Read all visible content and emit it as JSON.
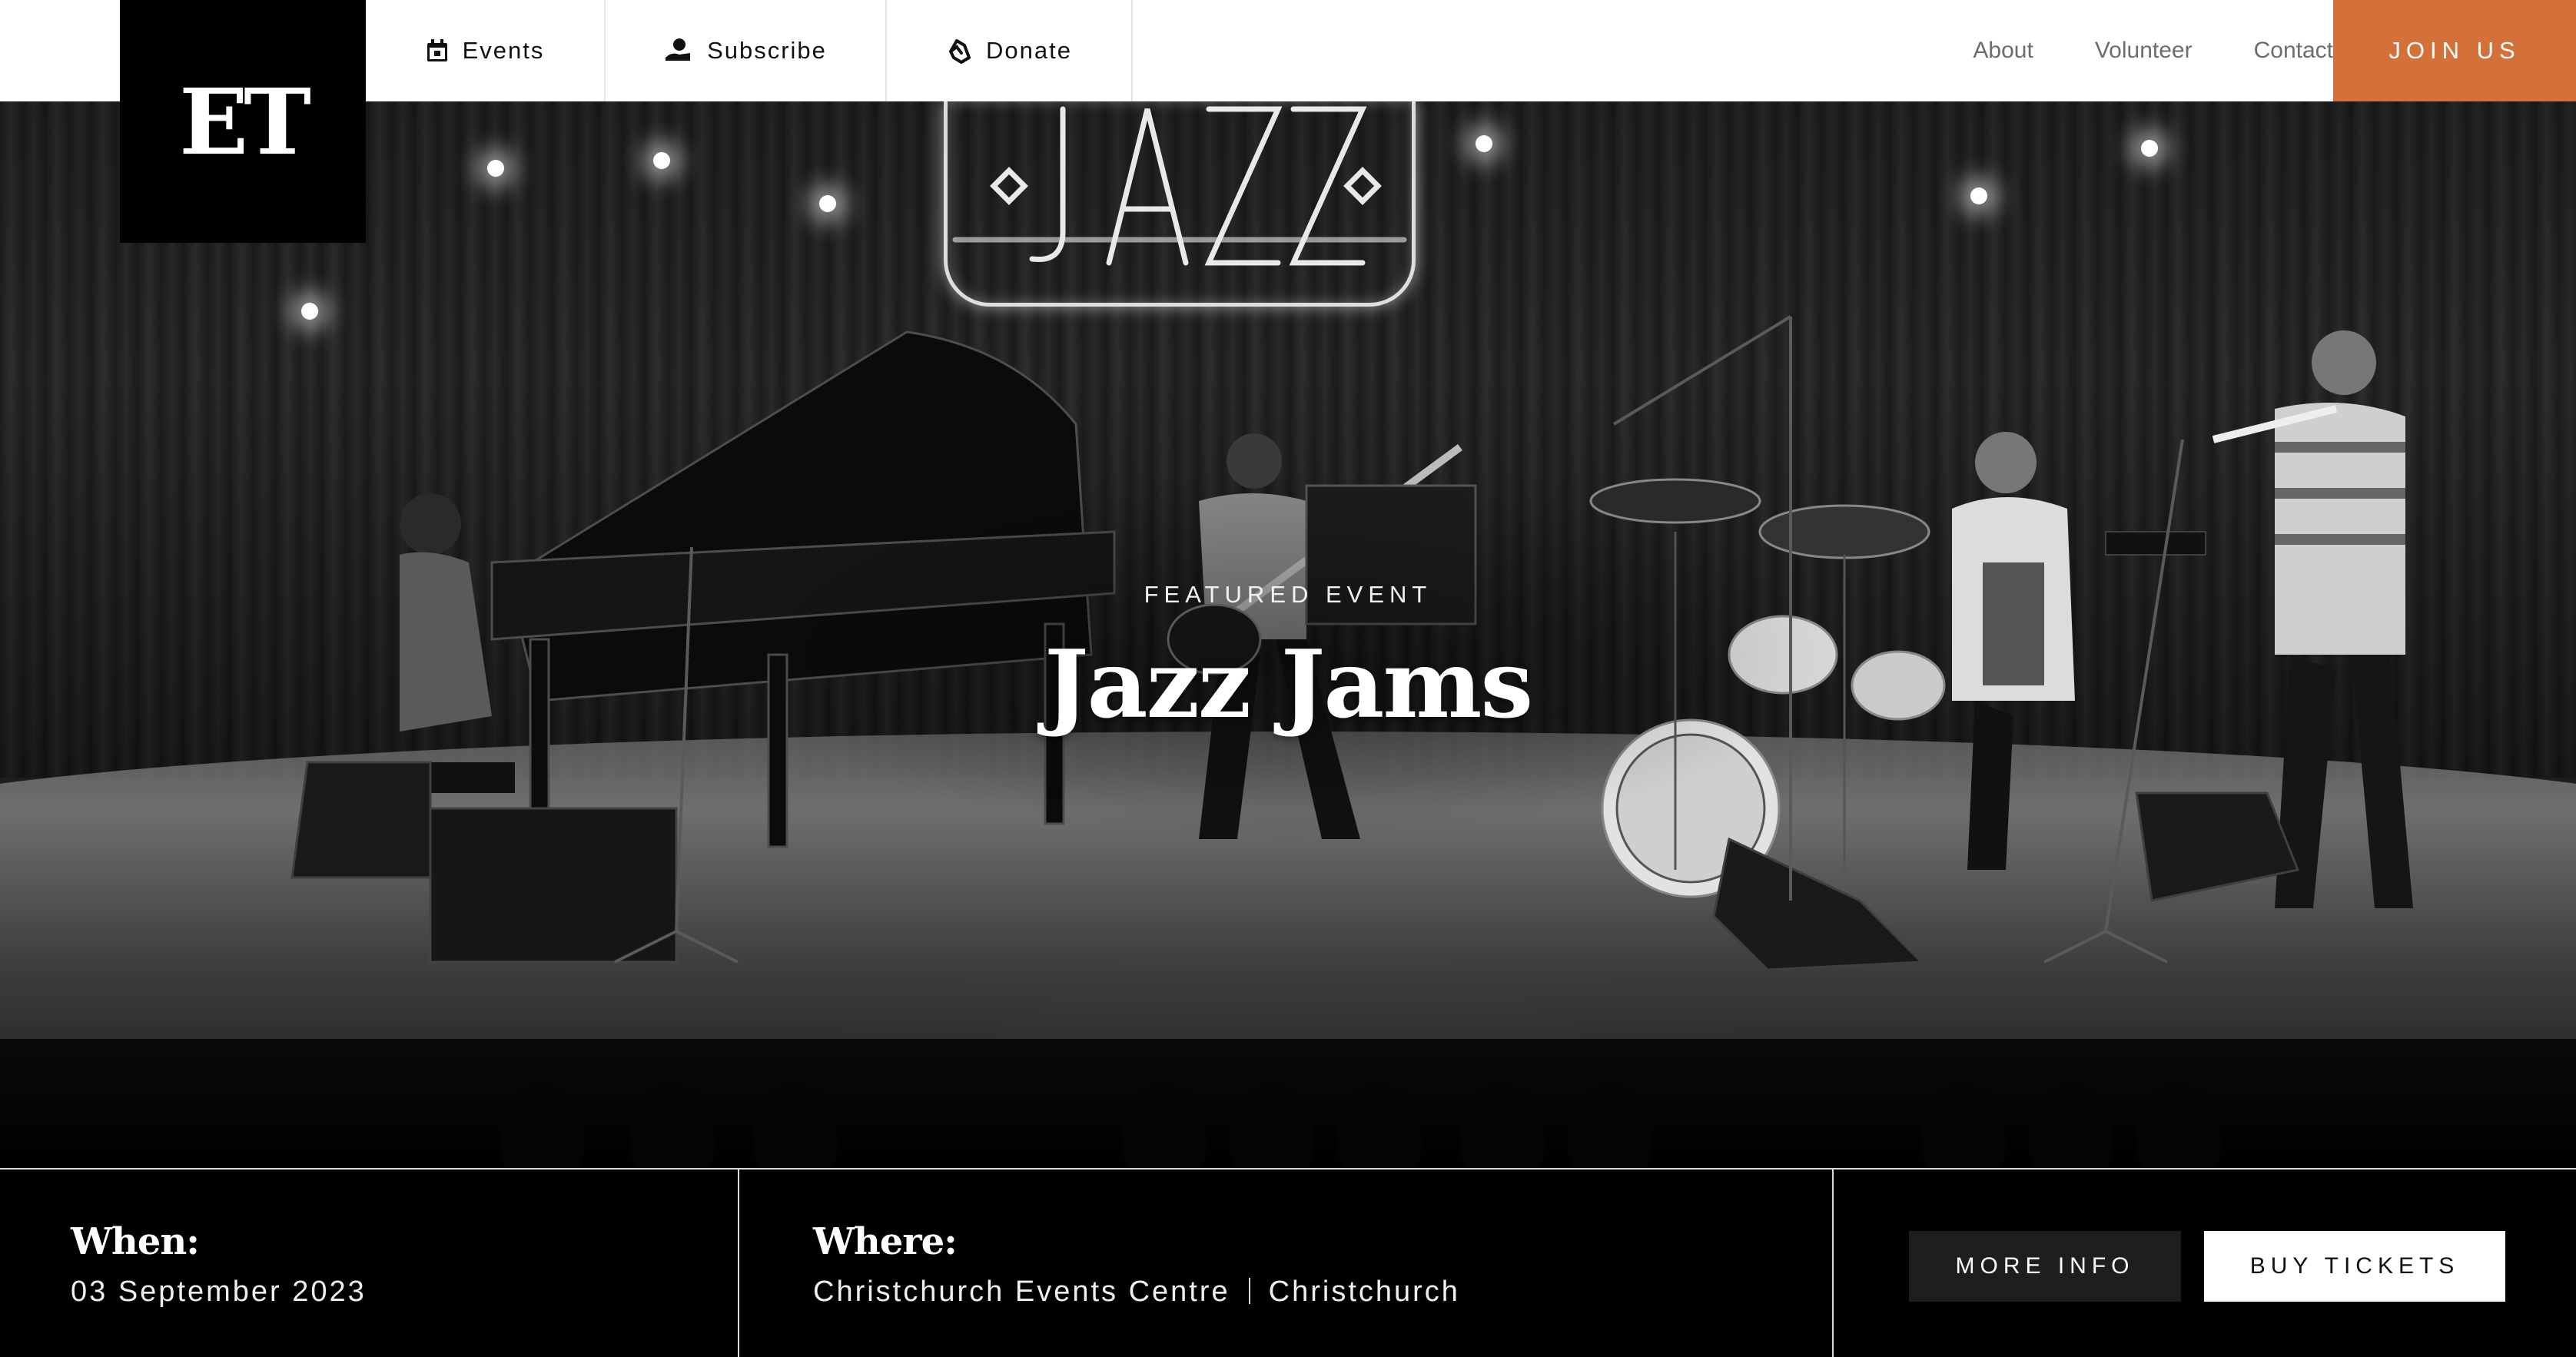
{
  "brand": {
    "logo_text": "ET"
  },
  "nav": {
    "left": [
      {
        "label": "Events",
        "icon": "calendar-icon"
      },
      {
        "label": "Subscribe",
        "icon": "subscribe-icon"
      },
      {
        "label": "Donate",
        "icon": "donate-icon"
      }
    ],
    "right": [
      "About",
      "Volunteer",
      "Contact"
    ],
    "cta": "JOIN US"
  },
  "hero": {
    "eyebrow": "FEATURED EVENT",
    "title": "Jazz Jams",
    "image_description_icon": "jazz-band-photo"
  },
  "details": {
    "when_label": "When:",
    "when_value": "03 September 2023",
    "where_label": "Where:",
    "venue": "Christchurch Events Centre",
    "city": "Christchurch"
  },
  "actions": {
    "more_info": "MORE INFO",
    "buy_tickets": "BUY TICKETS"
  },
  "colors": {
    "accent": "#d4703a",
    "background": "#000000",
    "nav_bg": "#ffffff"
  }
}
